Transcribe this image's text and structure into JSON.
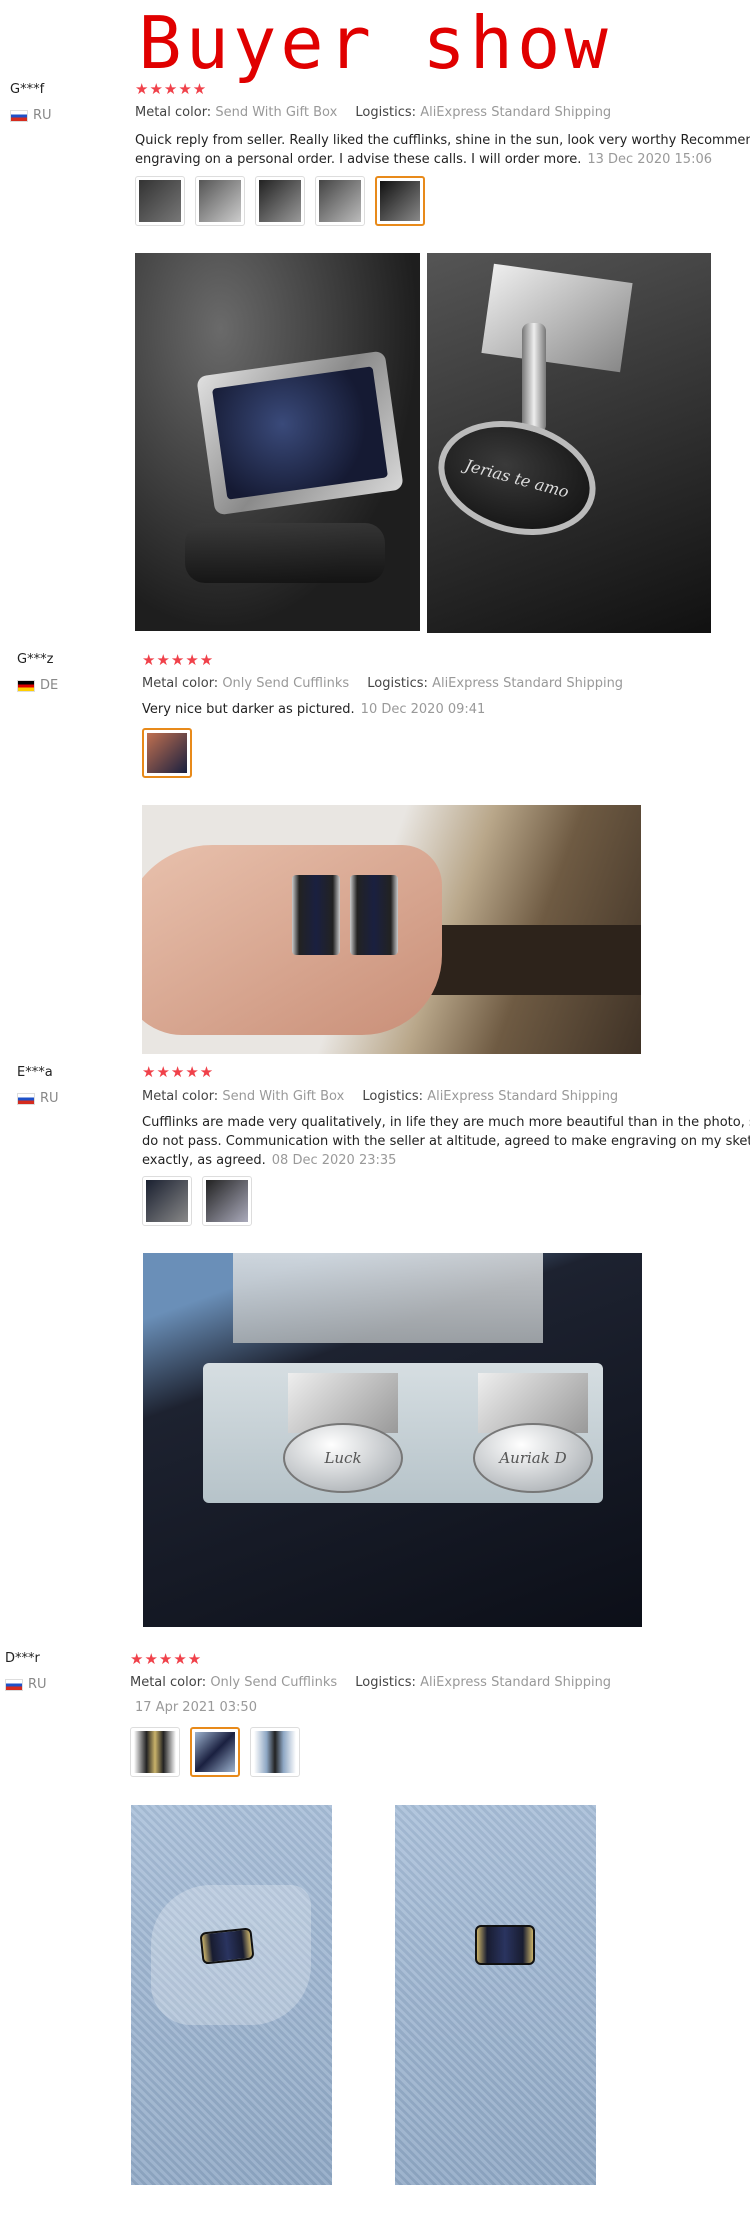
{
  "header": {
    "title": "Buyer show"
  },
  "colors": {
    "title": "#e00000",
    "stars": "#f0414a",
    "active_thumb": "#e88a1a"
  },
  "reviews": [
    {
      "buyer": "G***f",
      "country": "RU",
      "stars": "★★★★★",
      "metal_color_label": "Metal color:",
      "metal_color": "Send With Gift Box",
      "logistics_label": "Logistics:",
      "logistics": "AliExpress Standard Shipping",
      "text_line1": "Quick reply from seller. Really liked the cufflinks, shine in the sun, look very worthy Recommend. The s",
      "text_line2": "engraving on a personal order. I advise these calls. I will order more.",
      "date": "13 Dec 2020 15:06",
      "thumb_count": 5,
      "photo_caption": "Jerias te amo"
    },
    {
      "buyer": "G***z",
      "country": "DE",
      "stars": "★★★★★",
      "metal_color_label": "Metal color:",
      "metal_color": "Only Send Cufflinks",
      "logistics_label": "Logistics:",
      "logistics": "AliExpress Standard Shipping",
      "text_line1": "Very nice but darker as pictured.",
      "date": "10 Dec 2020 09:41",
      "thumb_count": 1
    },
    {
      "buyer": "E***a",
      "country": "RU",
      "stars": "★★★★★",
      "metal_color_label": "Metal color:",
      "metal_color": "Send With Gift Box",
      "logistics_label": "Logistics:",
      "logistics": "AliExpress Standard Shipping",
      "text_line1": "Cufflinks are made very qualitatively, in life they are much more beautiful than in the photo, such a g",
      "text_line2": "do not pass. Communication with the seller at altitude, agreed to make engraving on my sketch, ever",
      "text_line3": "exactly, as agreed.",
      "date": "08 Dec 2020 23:35",
      "thumb_count": 2,
      "engraving_left": "Luck",
      "engraving_right": "Auriak D"
    },
    {
      "buyer": "D***r",
      "country": "RU",
      "stars": "★★★★★",
      "metal_color_label": "Metal color:",
      "metal_color": "Only Send Cufflinks",
      "logistics_label": "Logistics:",
      "logistics": "AliExpress Standard Shipping",
      "date": "17 Apr 2021 03:50",
      "thumb_count": 3
    }
  ]
}
